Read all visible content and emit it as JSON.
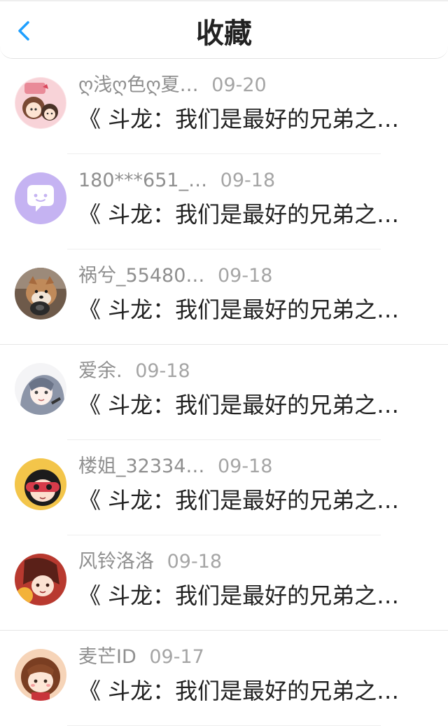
{
  "header": {
    "title": "收藏",
    "back_icon": "chevron-left-icon",
    "accent_color": "#1e9fff"
  },
  "favorites": [
    {
      "name": "ღ浅ღ色ღ夏…",
      "date": "09-20",
      "text": "《 斗龙：我们是最好的兄弟之…",
      "avatar_icon": "cartoon-girls-avatar"
    },
    {
      "name": "180***651_…",
      "date": "09-18",
      "text": "《 斗龙：我们是最好的兄弟之…",
      "avatar_icon": "chat-bubble-avatar"
    },
    {
      "name": "祸兮_55480…",
      "date": "09-18",
      "text": "《 斗龙：我们是最好的兄弟之…",
      "avatar_icon": "dog-photo-avatar"
    },
    {
      "name": "爱余.",
      "date": "09-18",
      "text": "《 斗龙：我们是最好的兄弟之…",
      "avatar_icon": "anime-girl-avatar"
    },
    {
      "name": "楼姐_32334…",
      "date": "09-18",
      "text": "《 斗龙：我们是最好的兄弟之…",
      "avatar_icon": "masked-character-avatar"
    },
    {
      "name": "风铃洛洛",
      "date": "09-18",
      "text": "《 斗龙：我们是最好的兄弟之…",
      "avatar_icon": "anime-red-avatar"
    },
    {
      "name": "麦芒ID",
      "date": "09-17",
      "text": "《 斗龙：我们是最好的兄弟之…",
      "avatar_icon": "cartoon-girl-avatar"
    }
  ]
}
